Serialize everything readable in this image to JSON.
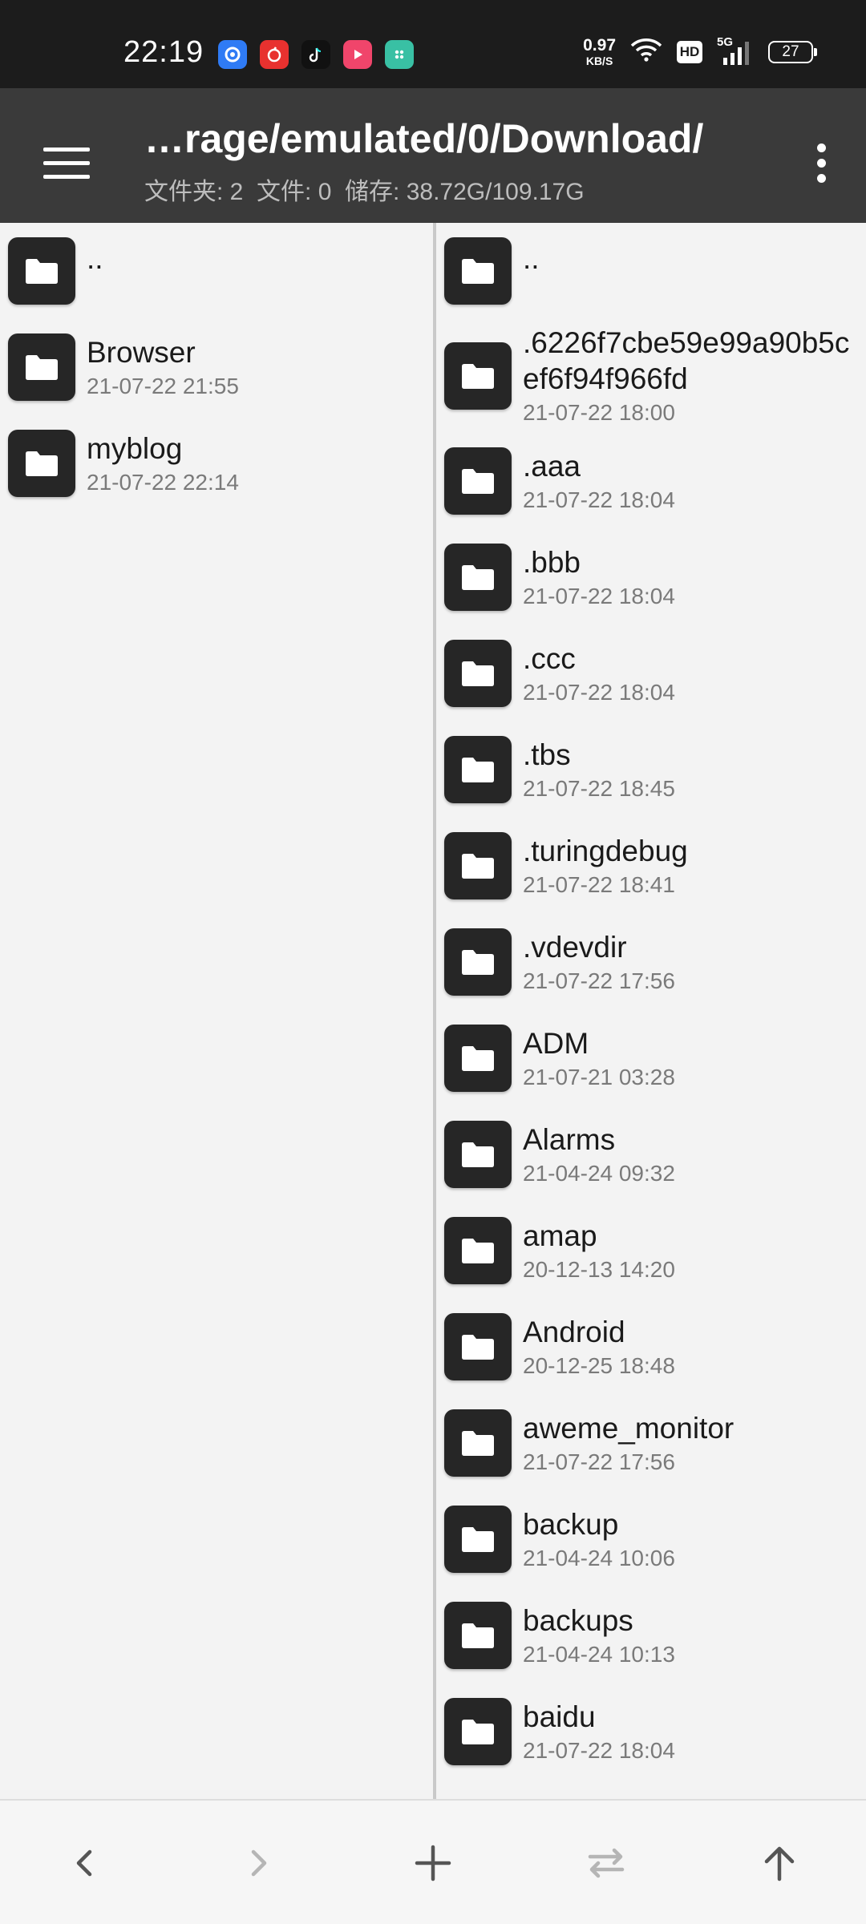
{
  "status_bar": {
    "time": "22:19",
    "net_speed_value": "0.97",
    "net_speed_unit": "KB/S",
    "hd_label": "HD",
    "network_label": "5G",
    "battery_level": "27",
    "notification_icons": [
      {
        "name": "browser-app-icon",
        "color": "#2f7bf5"
      },
      {
        "name": "netease-music-app-icon",
        "color": "#e8312f"
      },
      {
        "name": "tiktok-app-icon",
        "color": "#111111"
      },
      {
        "name": "video-app-icon",
        "color": "#f0456b"
      },
      {
        "name": "store-app-icon",
        "color": "#39c0a4"
      }
    ]
  },
  "app_bar": {
    "path": "…rage/emulated/0/Download/",
    "summary": "文件夹: 2  文件: 0  储存: 38.72G/109.17G"
  },
  "left_pane": {
    "items": [
      {
        "name": "..",
        "date": ""
      },
      {
        "name": "Browser",
        "date": "21-07-22 21:55"
      },
      {
        "name": "myblog",
        "date": "21-07-22 22:14"
      }
    ]
  },
  "right_pane": {
    "items": [
      {
        "name": "..",
        "date": ""
      },
      {
        "name": ".6226f7cbe59e99a90b5cef6f94f966fd",
        "date": "21-07-22 18:00"
      },
      {
        "name": ".aaa",
        "date": "21-07-22 18:04"
      },
      {
        "name": ".bbb",
        "date": "21-07-22 18:04"
      },
      {
        "name": ".ccc",
        "date": "21-07-22 18:04"
      },
      {
        "name": ".tbs",
        "date": "21-07-22 18:45"
      },
      {
        "name": ".turingdebug",
        "date": "21-07-22 18:41"
      },
      {
        "name": ".vdevdir",
        "date": "21-07-22 17:56"
      },
      {
        "name": "ADM",
        "date": "21-07-21 03:28"
      },
      {
        "name": "Alarms",
        "date": "21-04-24 09:32"
      },
      {
        "name": "amap",
        "date": "20-12-13 14:20"
      },
      {
        "name": "Android",
        "date": "20-12-25 18:48"
      },
      {
        "name": "aweme_monitor",
        "date": "21-07-22 17:56"
      },
      {
        "name": "backup",
        "date": "21-04-24 10:06"
      },
      {
        "name": "backups",
        "date": "21-04-24 10:13"
      },
      {
        "name": "baidu",
        "date": "21-07-22 18:04"
      }
    ]
  },
  "bottom_bar": {
    "buttons": [
      {
        "name": "back-button",
        "icon": "chevron-left-icon",
        "enabled": true
      },
      {
        "name": "forward-button",
        "icon": "chevron-right-icon",
        "enabled": false
      },
      {
        "name": "new-button",
        "icon": "plus-icon",
        "enabled": true
      },
      {
        "name": "swap-panes-button",
        "icon": "swap-icon",
        "enabled": false
      },
      {
        "name": "parent-dir-button",
        "icon": "arrow-up-icon",
        "enabled": true
      }
    ]
  },
  "colors": {
    "status_bar_bg": "#1c1c1c",
    "app_bar_bg": "#3a3a3a",
    "pane_bg": "#f3f3f3",
    "folder_tile": "#262626",
    "icon_enabled": "#555555",
    "icon_disabled": "#b5b5b5"
  }
}
